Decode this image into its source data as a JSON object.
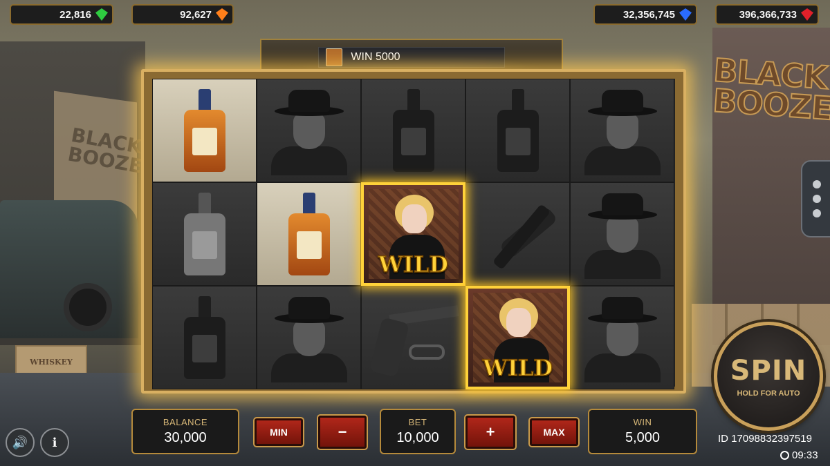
{
  "currencies": [
    {
      "value": "22,816",
      "gem_color": "#2ecc40",
      "icon": "green-gem-icon"
    },
    {
      "value": "92,627",
      "gem_color": "#ff7f1a",
      "icon": "orange-gem-icon"
    },
    {
      "value": "32,356,745",
      "gem_color": "#2a6bff",
      "icon": "blue-gem-icon"
    },
    {
      "value": "396,366,733",
      "gem_color": "#e0202a",
      "icon": "red-gem-icon"
    }
  ],
  "win_banner": {
    "text": "WIN 5000",
    "icon": "whiskey-bottle-icon"
  },
  "logo": {
    "line1": "BLACK",
    "line2": "BOOZE"
  },
  "background_signs": {
    "building_sign": "BLACK BOOZE",
    "crate_label": "WHISKEY"
  },
  "reels": [
    [
      "whiskey-bottle",
      "gangster",
      "bottle",
      "gangster",
      "wild"
    ],
    [
      "gangster",
      "whiskey-bottle",
      "gun",
      "wild",
      "gangster"
    ],
    [
      "bottle",
      "wild",
      "crowbar",
      "bottle",
      "gangster"
    ]
  ],
  "wild_label": "WILD",
  "controls": {
    "balance_label": "BALANCE",
    "balance_value": "30,000",
    "min_label": "MIN",
    "minus_label": "−",
    "bet_label": "BET",
    "bet_value": "10,000",
    "plus_label": "+",
    "max_label": "MAX",
    "win_label": "WIN",
    "win_value": "5,000"
  },
  "spin": {
    "label": "SPIN",
    "sub_label": "HOLD FOR AUTO"
  },
  "session_id": "ID 17098832397519",
  "time": "09:33",
  "icons": {
    "sound": "speaker-icon",
    "info": "info-icon",
    "menu": "more-dots-icon",
    "clock": "clock-icon"
  }
}
